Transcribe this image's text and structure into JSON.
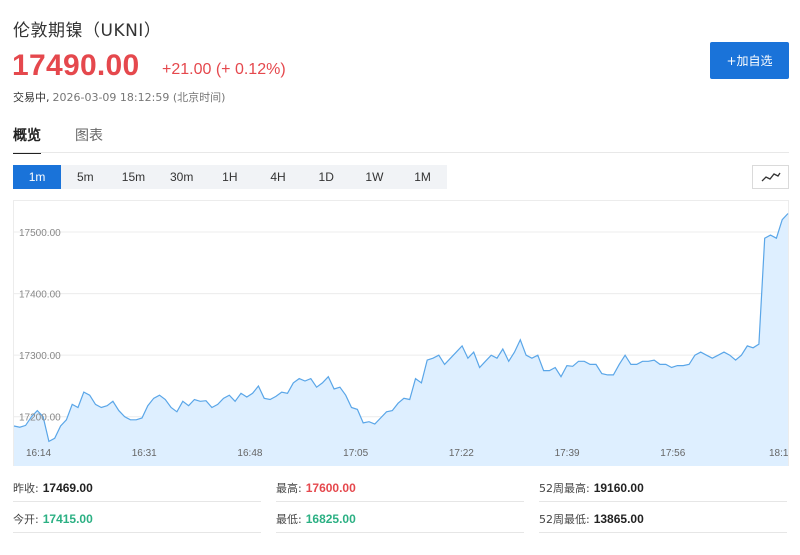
{
  "header": {
    "title": "伦敦期镍（UKNI）",
    "price": "17490.00",
    "change": "+21.00 (+ 0.12%)",
    "state": "交易中,",
    "timestamp": "2026-03-09 18:12:59 (北京时间)",
    "add_button": "+加自选"
  },
  "colors": {
    "accent": "#1a73d9",
    "up": "#e5484d",
    "down": "#2bb083",
    "line": "#5aa6e8",
    "fill": "#deefff"
  },
  "tabs": [
    {
      "label": "概览",
      "active": true
    },
    {
      "label": "图表",
      "active": false
    }
  ],
  "periods": [
    "1m",
    "5m",
    "15m",
    "30m",
    "1H",
    "4H",
    "1D",
    "1W",
    "1M"
  ],
  "active_period": "1m",
  "chart_type_icon": "line-chart-icon",
  "chart_data": {
    "type": "area",
    "x_tick_labels": [
      "16:14",
      "16:31",
      "16:48",
      "17:05",
      "17:22",
      "17:39",
      "17:56",
      "18:1"
    ],
    "y_tick_labels": [
      "17500.00",
      "17400.00",
      "17300.00",
      "17200.00"
    ],
    "y_ticks": [
      17500,
      17400,
      17300,
      17200
    ],
    "ylim": [
      17120,
      17552
    ],
    "grid": true,
    "values": [
      17185,
      17183,
      17186,
      17200,
      17210,
      17200,
      17160,
      17165,
      17185,
      17195,
      17220,
      17215,
      17240,
      17235,
      17220,
      17215,
      17218,
      17225,
      17210,
      17200,
      17195,
      17195,
      17198,
      17218,
      17230,
      17235,
      17228,
      17215,
      17208,
      17225,
      17218,
      17228,
      17225,
      17226,
      17215,
      17220,
      17230,
      17235,
      17225,
      17238,
      17232,
      17238,
      17250,
      17230,
      17228,
      17233,
      17240,
      17238,
      17255,
      17262,
      17258,
      17262,
      17248,
      17255,
      17265,
      17245,
      17248,
      17235,
      17215,
      17212,
      17190,
      17192,
      17188,
      17198,
      17208,
      17210,
      17222,
      17230,
      17228,
      17262,
      17255,
      17292,
      17295,
      17300,
      17285,
      17295,
      17305,
      17315,
      17295,
      17305,
      17280,
      17290,
      17300,
      17295,
      17310,
      17290,
      17305,
      17325,
      17300,
      17295,
      17300,
      17275,
      17275,
      17280,
      17265,
      17283,
      17282,
      17290,
      17290,
      17285,
      17285,
      17270,
      17268,
      17268,
      17285,
      17300,
      17285,
      17285,
      17290,
      17290,
      17292,
      17285,
      17285,
      17280,
      17283,
      17283,
      17285,
      17300,
      17305,
      17300,
      17295,
      17300,
      17305,
      17300,
      17292,
      17300,
      17315,
      17312,
      17318,
      17490,
      17495,
      17490,
      17520,
      17530
    ]
  },
  "stats": [
    {
      "label": "昨收:",
      "value": "17469.00",
      "tone": "neutral"
    },
    {
      "label": "最高:",
      "value": "17600.00",
      "tone": "up"
    },
    {
      "label": "52周最高:",
      "value": "19160.00",
      "tone": "neutral"
    },
    {
      "label": "今开:",
      "value": "17415.00",
      "tone": "down"
    },
    {
      "label": "最低:",
      "value": "16825.00",
      "tone": "down"
    },
    {
      "label": "52周最低:",
      "value": "13865.00",
      "tone": "neutral"
    }
  ]
}
